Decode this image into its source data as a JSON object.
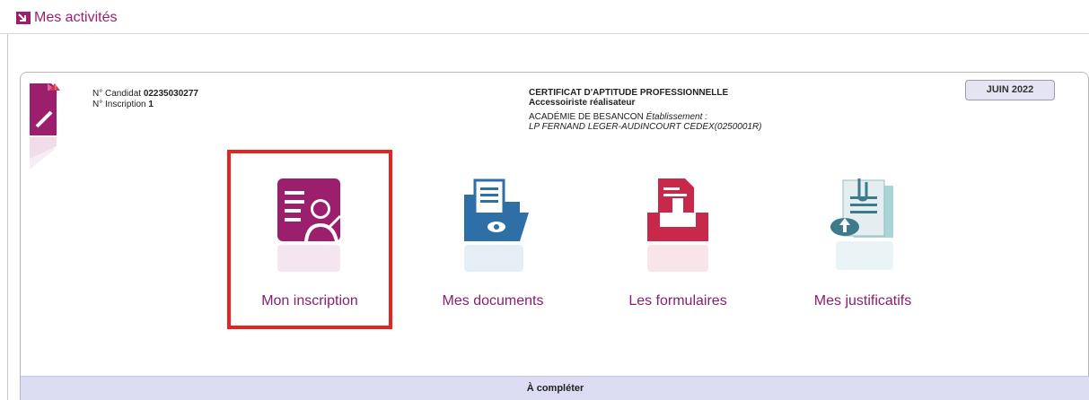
{
  "header": {
    "title": "Mes activités",
    "icon": "arrow-down-right-icon",
    "accent": "#9c1f6e"
  },
  "candidate": {
    "candidat_label": "N° Candidat",
    "candidat_number": "02235030277",
    "inscription_label": "N° Inscription",
    "inscription_number": "1"
  },
  "exam": {
    "title": "CERTIFICAT D'APTITUDE PROFESSIONNELLE",
    "specialty": "Accessoiriste réalisateur",
    "academy": "ACADÉMIE DE BESANCON",
    "etablissement_label": "Établissement :",
    "etablissement": "LP FERNAND LEGER-AUDINCOURT CEDEX(0250001R)"
  },
  "session": {
    "label": "JUIN 2022"
  },
  "tiles": [
    {
      "label": "Mon inscription",
      "icon": "registration-form-icon"
    },
    {
      "label": "Mes documents",
      "icon": "documents-folder-icon"
    },
    {
      "label": "Les formulaires",
      "icon": "forms-download-icon"
    },
    {
      "label": "Mes justificatifs",
      "icon": "proof-upload-icon"
    }
  ],
  "footer": {
    "status": "À compléter"
  },
  "colors": {
    "brand": "#9c1f6e",
    "docs_blue": "#2e6fa7",
    "forms_red": "#c8284a",
    "proof_teal": "#3c7a8c",
    "highlight": "#e52421",
    "status_bar": "#dcdcf3"
  }
}
